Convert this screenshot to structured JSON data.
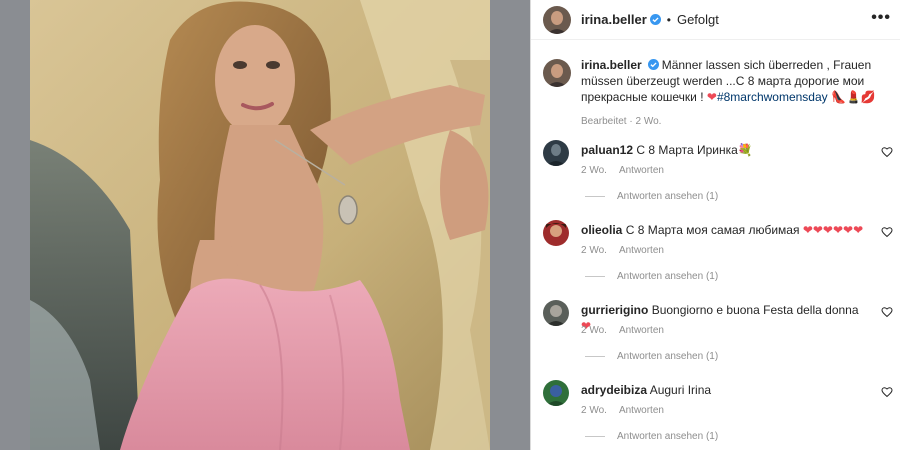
{
  "header": {
    "username": "irina.beller",
    "separator": "•",
    "follow_status": "Gefolgt",
    "more": "•••"
  },
  "caption": {
    "username": "irina.beller",
    "text": "Männer lassen sich überreden , Frauen müssen überzeugt werden ...С 8 марта дорогие мои прекрасные кошечки ! ",
    "heart": "❤",
    "hashtag": "#8marchwomensday",
    "emojis": "👠💄💋",
    "meta": "Bearbeitet · 2 Wo."
  },
  "comments": [
    {
      "username": "paluan12",
      "text": "С 8 Марта Иринка",
      "emoji": "💐",
      "age": "2 Wo.",
      "reply": "Antworten",
      "view_replies": "Antworten ansehen (1)"
    },
    {
      "username": "olieolia",
      "text": "С 8 Марта моя самая любимая",
      "emoji": "❤❤❤❤❤❤",
      "age": "2 Wo.",
      "reply": "Antworten",
      "view_replies": "Antworten ansehen (1)"
    },
    {
      "username": "gurrierigino",
      "text": "Buongiorno e buona Festa della donna",
      "emoji": "❤",
      "age": "2 Wo.",
      "reply": "Antworten",
      "view_replies": "Antworten ansehen (1)"
    },
    {
      "username": "adrydeibiza",
      "text": "Auguri Irina",
      "emoji": "",
      "age": "2 Wo.",
      "reply": "Antworten",
      "view_replies": "Antworten ansehen (1)"
    }
  ],
  "colors": {
    "verified": "#3897f0",
    "hashtag": "#00376b",
    "heart": "#ed4956",
    "muted": "#8e8e8e",
    "dress": "#e7a1b0",
    "rock": "#cdb98c"
  },
  "icons": [
    "verified-badge-icon",
    "more-options-icon",
    "heart-outline-icon"
  ]
}
